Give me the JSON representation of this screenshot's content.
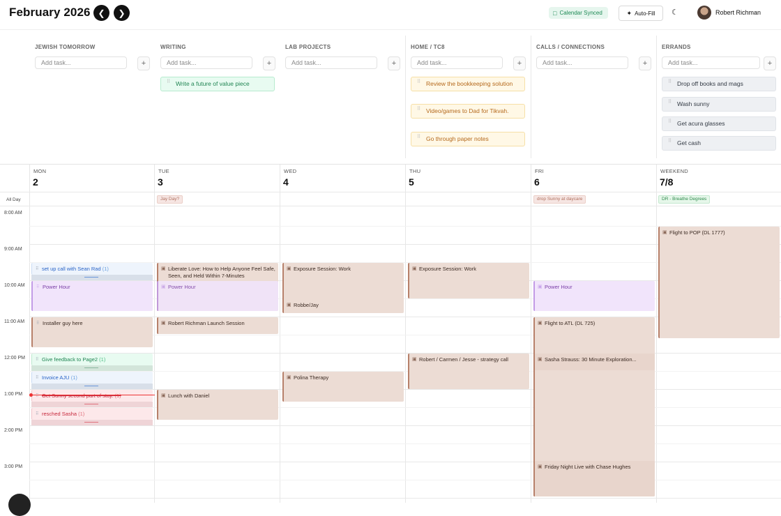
{
  "header": {
    "title": "February 2026",
    "calendar_synced": "Calendar Synced",
    "auto_fill": "Auto-Fill",
    "user_name": "Robert Richman"
  },
  "task_columns": [
    {
      "title": "JEWISH TOMORROW",
      "placeholder": "Add task...",
      "tasks": []
    },
    {
      "title": "WRITING",
      "placeholder": "Add task...",
      "tasks": [
        "Write a future of value piece"
      ]
    },
    {
      "title": "LAB PROJECTS",
      "placeholder": "Add task...",
      "tasks": []
    },
    {
      "title": "HOME / TC8",
      "placeholder": "Add task...",
      "tasks": [
        "Review the bookkeeping solution",
        "Video/games to Dad for Tikvah.",
        "Go through paper notes"
      ]
    },
    {
      "title": "CALLS / CONNECTIONS",
      "placeholder": "Add task...",
      "tasks": []
    },
    {
      "title": "ERRANDS",
      "placeholder": "Add task...",
      "tasks": [
        "Drop off books and mags",
        "Wash sunny",
        "Get acura glasses",
        "Get cash"
      ]
    }
  ],
  "calendar": {
    "days": [
      {
        "name": "MON",
        "num": "2"
      },
      {
        "name": "TUE",
        "num": "3"
      },
      {
        "name": "WED",
        "num": "4"
      },
      {
        "name": "THU",
        "num": "5"
      },
      {
        "name": "FRI",
        "num": "6"
      },
      {
        "name": "WEEKEND",
        "num": "7/8"
      }
    ],
    "all_day_label": "All Day",
    "all_day_events": {
      "tue": "Jay Day?",
      "fri": "drop Sunny at daycare",
      "weekend": "DR - Breathe Degrees"
    },
    "times": [
      "8:00 AM",
      "9:00 AM",
      "10:00 AM",
      "11:00 AM",
      "12:00 PM",
      "1:00 PM",
      "2:00 PM",
      "3:00 PM"
    ],
    "events": {
      "mon_setup_call": "set up call with Sean Rad",
      "mon_setup_call_count": "(1)",
      "mon_power_hour": "Power Hour",
      "mon_installer": "Installer guy here",
      "mon_feedback": "Give feedback to Page2",
      "mon_feedback_count": "(1)",
      "mon_invoice": "Invoice AJU",
      "mon_invoice_count": "(1)",
      "mon_sunny": "Get Sunny second part of stay.",
      "mon_sunny_count": "(1)",
      "mon_resched": "resched Sasha",
      "mon_resched_count": "(1)",
      "tue_liberate": "Liberate Love: How to Help Anyone Feel Safe, Seen, and Held Within 7-Minutes",
      "tue_power_hour": "Power Hour",
      "tue_launch": "Robert Richman Launch Session",
      "tue_lunch": "Lunch with Daniel",
      "wed_exposure": "Exposure Session: Work",
      "wed_robbe": "Robbe/Jay",
      "wed_polina": "Polina Therapy",
      "thu_exposure": "Exposure Session: Work",
      "thu_strategy": "Robert / Carmen / Jesse - strategy call",
      "fri_power_hour": "Power Hour",
      "fri_flight": "Flight to ATL (DL 725)",
      "fri_sasha": "Sasha Strauss: 30 Minute Exploration...",
      "fri_friday_night": "Friday Night Live with Chase Hughes",
      "weekend_flight": "Flight to POP (DL 1777)"
    }
  }
}
